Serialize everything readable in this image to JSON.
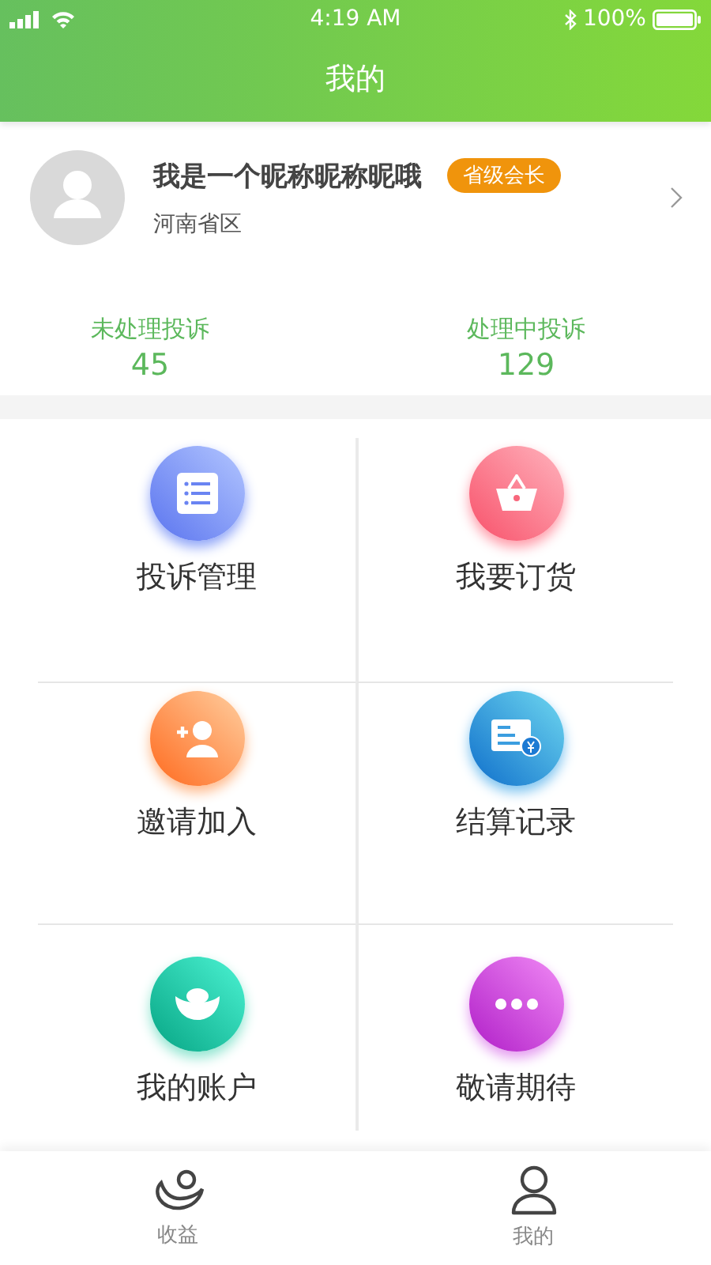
{
  "status_bar": {
    "time": "4:19 AM",
    "battery": "100%"
  },
  "header": {
    "title": "我的"
  },
  "profile": {
    "nickname": "我是一个昵称昵称昵哦",
    "badge": "省级会长",
    "region": "河南省区"
  },
  "stats": [
    {
      "label": "未处理投诉",
      "value": "45"
    },
    {
      "label": "处理中投诉",
      "value": "129"
    }
  ],
  "menu": [
    {
      "label": "投诉管理",
      "kind": "list"
    },
    {
      "label": "我要订货",
      "kind": "basket"
    },
    {
      "label": "邀请加入",
      "kind": "invite"
    },
    {
      "label": "结算记录",
      "kind": "bill"
    },
    {
      "label": "我的账户",
      "kind": "ingot"
    },
    {
      "label": "敬请期待",
      "kind": "more"
    }
  ],
  "tab_bar": [
    {
      "label": "收益",
      "kind": "income"
    },
    {
      "label": "我的",
      "kind": "user"
    }
  ]
}
